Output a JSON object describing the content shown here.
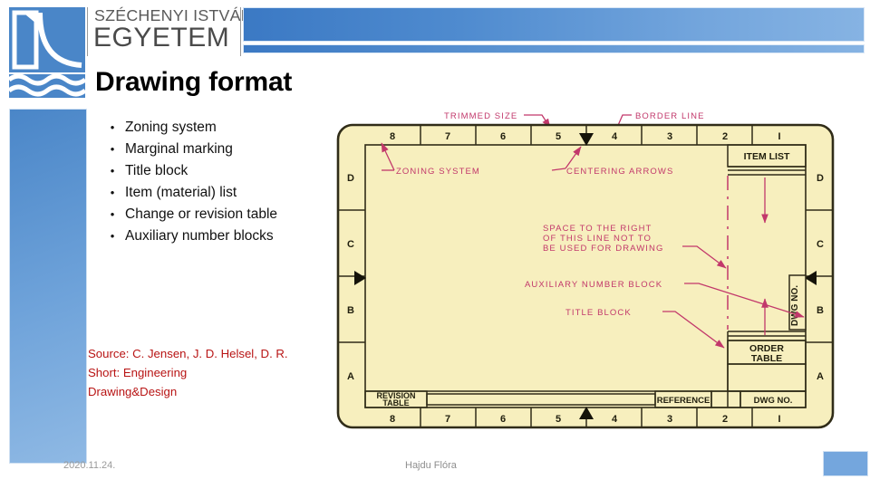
{
  "brand": {
    "line1": "SZÉCHENYI ISTVÁN",
    "line2": "EGYETEM",
    "logo_icon": "szechenyi-university-logo",
    "accent": "#4a86c8"
  },
  "title": "Drawing format",
  "bullets": [
    {
      "bullet": "•",
      "label": "Zoning system"
    },
    {
      "bullet": "•",
      "label": "Marginal marking"
    },
    {
      "bullet": "•",
      "label": "Title block"
    },
    {
      "bullet": "•",
      "label": "Item (material) list"
    },
    {
      "bullet": "•",
      "label": "Change or revision table"
    },
    {
      "bullet": "•",
      "label": "Auxiliary number blocks"
    }
  ],
  "source": {
    "line1": "Source: C. Jensen, J. D. Helsel, D. R.",
    "line2": "Short: Engineering",
    "line3": "Drawing&Design",
    "color": "#b81414"
  },
  "footer": {
    "date": "2020.11.24.",
    "author": "Hajdu Flóra"
  },
  "figure": {
    "name": "drawing-format-diagram",
    "paper_color": "#f7efbe",
    "ink_color": "#3a3420",
    "annotation_color": "#c2386b",
    "callouts": [
      "TRIMMED SIZE",
      "BORDER LINE",
      "ZONING SYSTEM",
      "CENTERING ARROWS",
      "SPACE TO THE RIGHT",
      "OF THIS LINE NOT TO",
      "BE USED FOR DRAWING",
      "AUXILIARY NUMBER BLOCK",
      "TITLE BLOCK"
    ],
    "top_zone_numbers": [
      "8",
      "7",
      "6",
      "5",
      "4",
      "3",
      "2",
      "I"
    ],
    "bottom_zone_numbers": [
      "8",
      "7",
      "6",
      "5",
      "4",
      "3",
      "2",
      "I"
    ],
    "left_zone_letters": [
      "D",
      "C",
      "B",
      "A"
    ],
    "right_zone_letters": [
      "D",
      "C",
      "B",
      "A"
    ],
    "blocks": {
      "item_list": "ITEM LIST",
      "order_table_l1": "ORDER",
      "order_table_l2": "TABLE",
      "dwg_no_side": "DWG NO.",
      "revision_l1": "REVISION",
      "revision_l2": "TABLE",
      "reference": "REFERENCE",
      "dwg_no_bottom": "DWG NO."
    }
  }
}
